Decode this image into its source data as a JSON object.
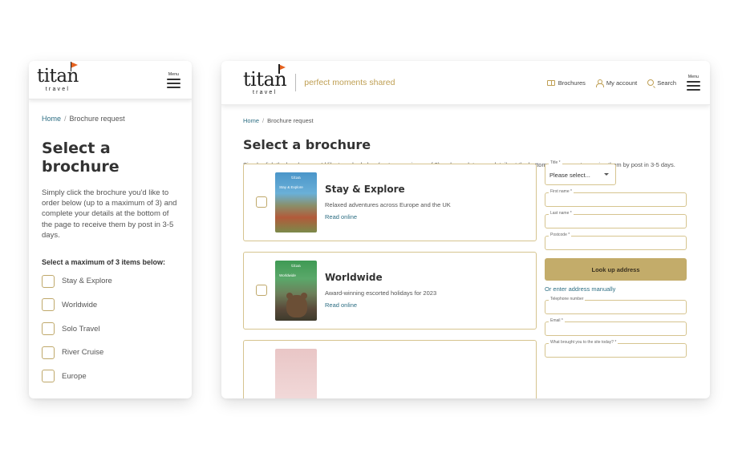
{
  "brand": {
    "name": "titan",
    "sub": "travel",
    "tagline": "perfect moments shared",
    "accent": "#bf9f53",
    "link_color": "#2d6e83"
  },
  "menu": {
    "label": "Menu"
  },
  "breadcrumb": {
    "home": "Home",
    "separator": "/",
    "current": "Brochure request"
  },
  "nav": {
    "brochures": "Brochures",
    "account": "My account",
    "search": "Search"
  },
  "page": {
    "title": "Select a brochure",
    "intro": "Simply click the brochure you'd like to order below (up to a maximum of 3) and complete your details at the bottom of the page to receive them by post in 3-5 days.",
    "select_label": "Select a maximum of 3 items below:"
  },
  "mobile_list": [
    "Stay & Explore",
    "Worldwide",
    "Solo Travel",
    "River Cruise",
    "Europe"
  ],
  "cards": [
    {
      "title": "Stay & Explore",
      "description": "Relaxed adventures across Europe and the UK",
      "link": "Read online",
      "cover_text": "Stay & Explore"
    },
    {
      "title": "Worldwide",
      "description": "Award-winning escorted holidays for 2023",
      "link": "Read online",
      "cover_text": "Worldwide"
    }
  ],
  "form": {
    "title_label": "Title *",
    "title_value": "Please select...",
    "first_name_label": "First name *",
    "last_name_label": "Last name *",
    "postcode_label": "Postcode *",
    "lookup_button": "Look up address",
    "manual_link": "Or enter address manually",
    "telephone_label": "Telephone number",
    "email_label": "Email *",
    "referral_label": "What brought you to the site today? *"
  }
}
